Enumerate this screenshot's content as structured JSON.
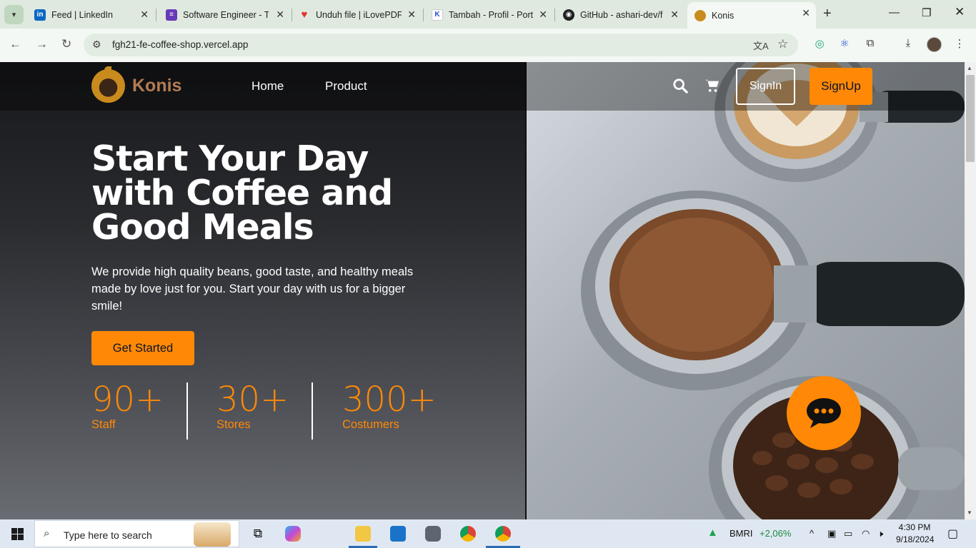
{
  "browser": {
    "tabs": [
      {
        "title": "Feed | LinkedIn",
        "favicon": "linkedin-icon",
        "color": "#0a66c2",
        "glyph": "in"
      },
      {
        "title": "Software Engineer - T",
        "favicon": "forms-icon",
        "color": "#673ab7",
        "glyph": "≡"
      },
      {
        "title": "Unduh file | iLovePDF",
        "favicon": "ilovepdf-icon",
        "color": "#e5322d",
        "glyph": "♥"
      },
      {
        "title": "Tambah - Profil - Port",
        "favicon": "kalibrr-icon",
        "color": "#ffffff",
        "glyph": "K"
      },
      {
        "title": "GitHub - ashari-dev/f",
        "favicon": "github-icon",
        "color": "#1f1f1f",
        "glyph": "●"
      },
      {
        "title": "Konis",
        "favicon": "konis-icon",
        "color": "#c98b1e",
        "glyph": "●"
      }
    ],
    "url": "fgh21-fe-coffee-shop.vercel.app"
  },
  "site": {
    "brand": "Konis",
    "nav": {
      "home": "Home",
      "product": "Product"
    },
    "signin": "SignIn",
    "signup": "SignUp",
    "hero": {
      "title": "Start Your Day with Coffee and Good Meals",
      "description": "We provide high quality beans, good taste, and healthy meals made by love just for you. Start your day with us for a bigger smile!",
      "cta": "Get Started"
    },
    "stats": [
      {
        "value": "90+",
        "label": "Staff"
      },
      {
        "value": "30+",
        "label": "Stores"
      },
      {
        "value": "300+",
        "label": "Costumers"
      }
    ],
    "accent": "#ff8906"
  },
  "taskbar": {
    "search_placeholder": "Type here to search",
    "stock": {
      "ticker": "BMRI",
      "change": "+2,06%"
    },
    "time": "4:30 PM",
    "date": "9/18/2024"
  }
}
